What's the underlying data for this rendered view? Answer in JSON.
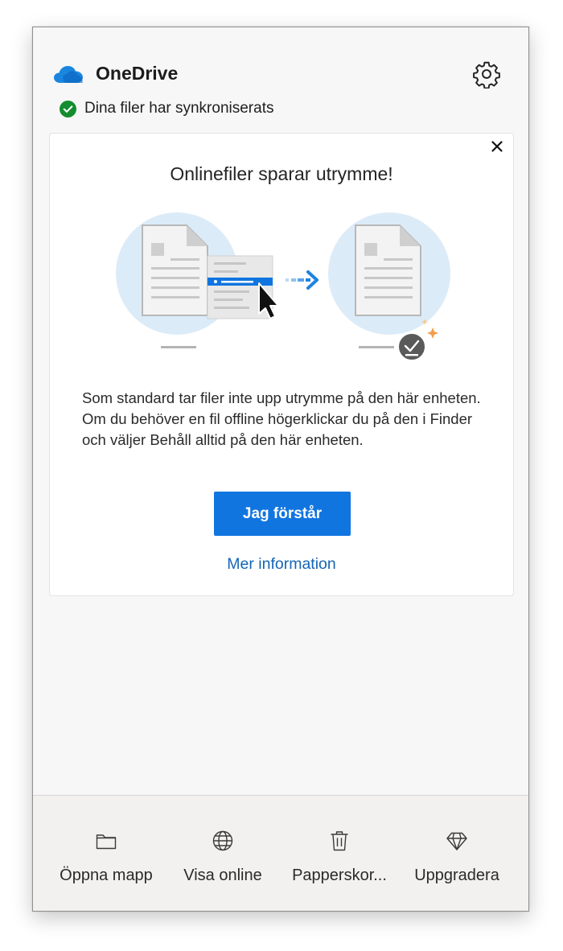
{
  "app": {
    "title": "OneDrive"
  },
  "status": {
    "text": "Dina filer har synkroniserats",
    "color": "#138d2e"
  },
  "card": {
    "title": "Onlinefiler sparar utrymme!",
    "body": "Som standard tar filer inte upp utrymme på den här enheten. Om du behöver en fil offline högerklickar du på den i Finder och väljer Behåll alltid på den här enheten.",
    "primary_button": "Jag förstår",
    "link": "Mer information"
  },
  "footer": {
    "items": [
      {
        "label": "Öppna mapp",
        "icon": "folder-icon"
      },
      {
        "label": "Visa online",
        "icon": "globe-icon"
      },
      {
        "label": "Papperskor...",
        "icon": "trash-icon"
      },
      {
        "label": "Uppgradera",
        "icon": "diamond-icon"
      }
    ]
  },
  "colors": {
    "accent": "#1175e0",
    "link": "#1565b5",
    "brand_cloud": "#0f6fd6"
  }
}
